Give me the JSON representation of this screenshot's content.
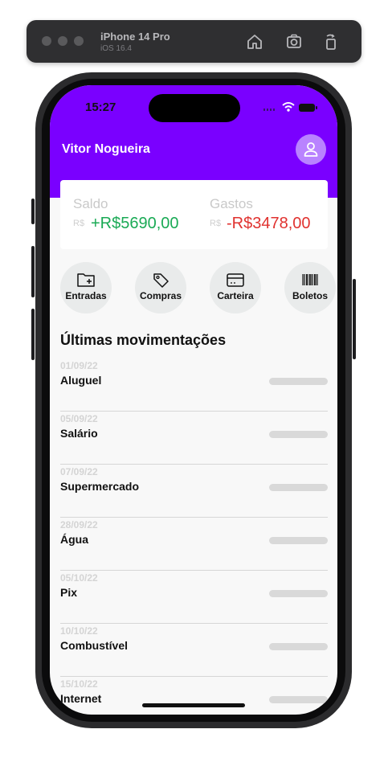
{
  "simulator": {
    "device_name": "iPhone 14 Pro",
    "os_version": "iOS 16.4",
    "icons": [
      "home-icon",
      "screenshot-icon",
      "rotate-icon"
    ]
  },
  "status_bar": {
    "time": "15:27",
    "icons": [
      "cellular-icon",
      "wifi-icon",
      "battery-icon"
    ]
  },
  "header": {
    "user_name": "Vitor Nogueira",
    "avatar_icon": "user-icon",
    "color": "#7a00ff"
  },
  "balance": {
    "saldo_label": "Saldo",
    "saldo_currency": "R$",
    "saldo_value": "+R$5690,00",
    "gastos_label": "Gastos",
    "gastos_currency": "R$",
    "gastos_value": "-R$3478,00",
    "income_color": "#1aaa55",
    "expense_color": "#e0322f"
  },
  "actions": [
    {
      "label": "Entradas",
      "icon": "folder-plus-icon"
    },
    {
      "label": "Compras",
      "icon": "tag-icon"
    },
    {
      "label": "Carteira",
      "icon": "credit-card-icon"
    },
    {
      "label": "Boletos",
      "icon": "barcode-icon"
    }
  ],
  "transactions_title": "Últimas movimentações",
  "transactions": [
    {
      "date": "01/09/22",
      "name": "Aluguel"
    },
    {
      "date": "05/09/22",
      "name": "Salário"
    },
    {
      "date": "07/09/22",
      "name": "Supermercado"
    },
    {
      "date": "28/09/22",
      "name": "Água"
    },
    {
      "date": "05/10/22",
      "name": "Pix"
    },
    {
      "date": "10/10/22",
      "name": "Combustível"
    },
    {
      "date": "15/10/22",
      "name": "Internet"
    }
  ]
}
